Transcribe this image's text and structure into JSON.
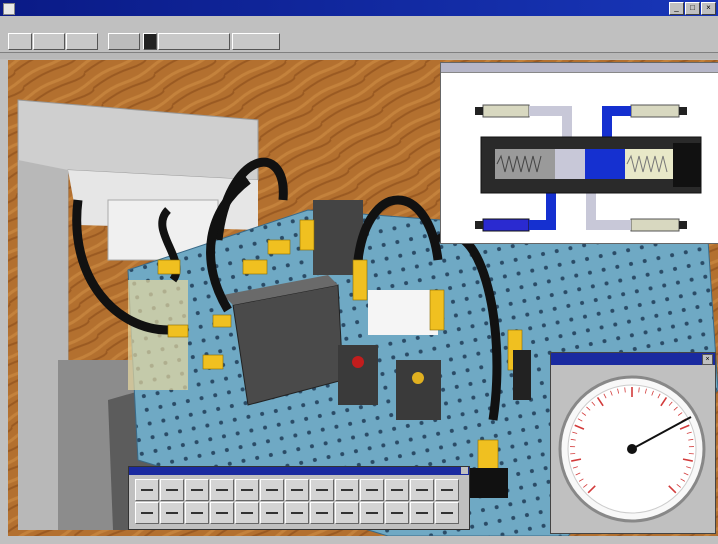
{
  "window": {
    "title": ""
  },
  "menu": [
    "",
    "",
    "",
    "",
    "",
    "",
    "",
    ""
  ],
  "toolbar": {
    "buttons": [
      "",
      "",
      "",
      "",
      "",
      ""
    ]
  },
  "gauge_window": {
    "title": ""
  },
  "palette_window": {
    "title": ""
  },
  "status": {
    "text": ""
  },
  "colors": {
    "titlebar": "#0a1a86",
    "floor": "#b06a30",
    "board": "#6fa9c4",
    "fitting": "#f0c020",
    "hose": "#111111",
    "hydraulic_flow": "#1530d0"
  },
  "icons": [
    "app-icon",
    "minimize-icon",
    "maximize-icon",
    "close-icon",
    "gauge-icon"
  ]
}
